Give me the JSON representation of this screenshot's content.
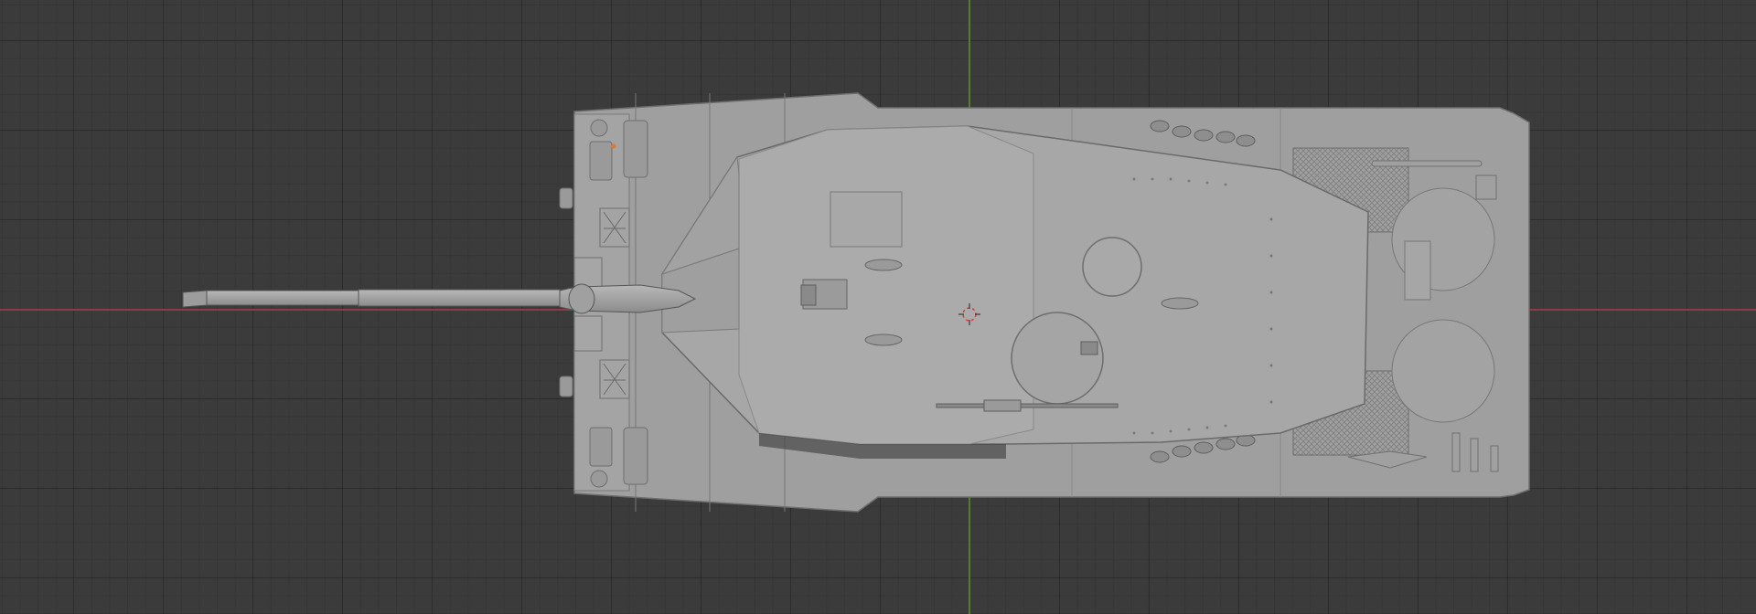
{
  "viewport": {
    "mode": "top-orthographic",
    "object": "tank",
    "grid": true,
    "colors": {
      "background": "#3b3b3b",
      "x_axis": "#8a3d46",
      "y_axis": "#5a7a2c",
      "model": "#a7a7a7",
      "origin": "#e07a2a"
    }
  }
}
